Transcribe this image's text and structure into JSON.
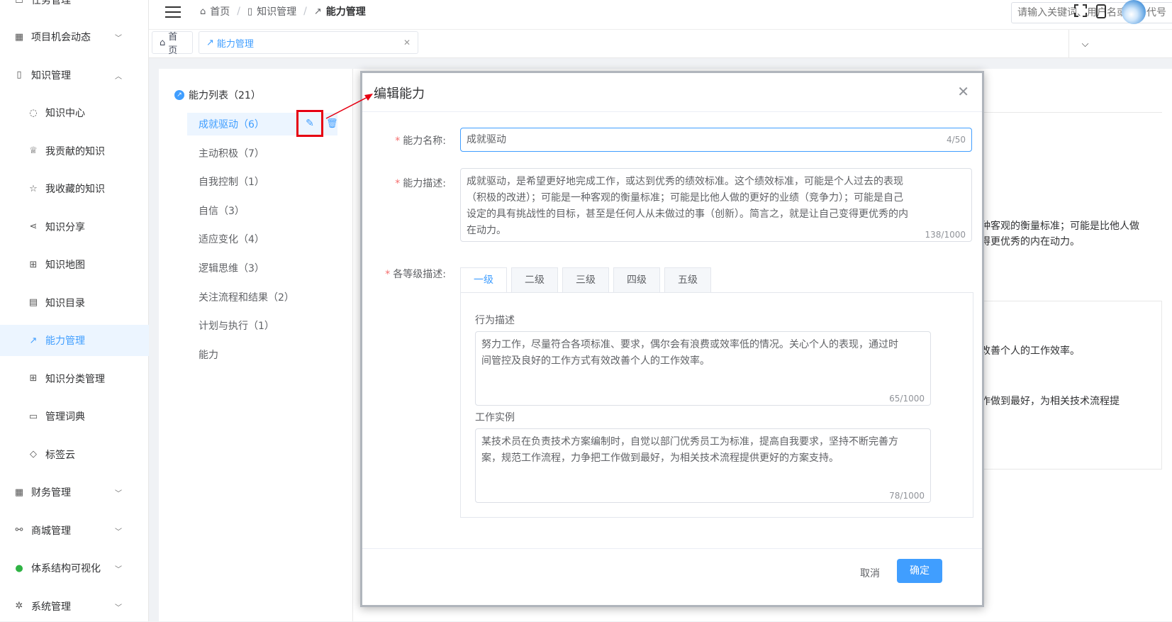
{
  "sidebar": {
    "top_partial": "任务管理",
    "items": [
      {
        "label": "项目机会动态",
        "icon": "calendar-icon",
        "type": "top",
        "chevron": "down"
      },
      {
        "label": "知识管理",
        "icon": "book-icon",
        "type": "top",
        "chevron": "up"
      },
      {
        "label": "知识中心",
        "icon": "bulb-icon",
        "type": "sub"
      },
      {
        "label": "我贡献的知识",
        "icon": "trophy-icon",
        "type": "sub"
      },
      {
        "label": "我收藏的知识",
        "icon": "star-icon",
        "type": "sub"
      },
      {
        "label": "知识分享",
        "icon": "share-icon",
        "type": "sub"
      },
      {
        "label": "知识地图",
        "icon": "sitemap-icon",
        "type": "sub"
      },
      {
        "label": "知识目录",
        "icon": "list-icon",
        "type": "sub"
      },
      {
        "label": "能力管理",
        "icon": "trend-icon",
        "type": "sub",
        "active": true
      },
      {
        "label": "知识分类管理",
        "icon": "grid-icon",
        "type": "sub"
      },
      {
        "label": "管理词典",
        "icon": "dictionary-icon",
        "type": "sub"
      },
      {
        "label": "标签云",
        "icon": "tag-icon",
        "type": "sub"
      },
      {
        "label": "财务管理",
        "icon": "table-icon",
        "type": "top",
        "chevron": "down"
      },
      {
        "label": "商城管理",
        "icon": "shop-icon",
        "type": "top",
        "chevron": "down"
      },
      {
        "label": "体系结构可视化",
        "icon": "user-icon",
        "type": "top",
        "chevron": "down"
      },
      {
        "label": "系统管理",
        "icon": "gear-icon",
        "type": "top",
        "chevron": "down"
      }
    ]
  },
  "header": {
    "breadcrumb": [
      "首页",
      "知识管理",
      "能力管理"
    ],
    "search_placeholder": "请输入关键词、用户名或项目代号"
  },
  "tabs": [
    {
      "label": "首页",
      "icon": "home-icon"
    },
    {
      "label": "能力管理",
      "icon": "trend-icon",
      "active": true
    }
  ],
  "tree": {
    "root": "能力列表（21）",
    "items": [
      "成就驱动（6）",
      "主动积极（7）",
      "自我控制（1）",
      "自信（3）",
      "适应变化（4）",
      "逻辑思维（3）",
      "关注流程和结果（2）",
      "计划与执行（1）",
      "能力"
    ]
  },
  "background": {
    "line1": "种客观的衡量标准；可能是比他人做",
    "line2": "得更优秀的内在动力。",
    "line3": "改善个人的工作效率。",
    "line4": "作做到最好，为相关技术流程提"
  },
  "dialog": {
    "title": "编辑能力",
    "name_label": "能力名称:",
    "name_value": "成就驱动",
    "name_count": "4/50",
    "desc_label": "能力描述:",
    "desc_lines": [
      "成就驱动，是希望更好地完成工作，或达到优秀的绩效标准。这个绩效标准，可能是个人过去的表现",
      "（积极的改进）；可能是一种客观的衡量标准；可能是比他人做的更好的业绩（竞争力）；可能是自己",
      "设定的具有挑战性的目标，甚至是任何人从未做过的事（创新）。简言之，就是让自己变得更优秀的内",
      "在动力。"
    ],
    "desc_count": "138/1000",
    "levels_label": "各等级描述:",
    "level_tabs": [
      "一级",
      "二级",
      "三级",
      "四级",
      "五级"
    ],
    "behavior_label": "行为描述",
    "behavior_lines": [
      "努力工作，尽量符合各项标准、要求，偶尔会有浪费或效率低的情况。关心个人的表现，通过时",
      "间管控及良好的工作方式有效改善个人的工作效率。"
    ],
    "behavior_count": "65/1000",
    "example_label": "工作实例",
    "example_lines": [
      "某技术员在负责技术方案编制时，自觉以部门优秀员工为标准，提高自我要求，坚持不断完善方",
      "案，规范工作流程，力争把工作做到最好，为相关技术流程提供更好的方案支持。"
    ],
    "example_count": "78/1000",
    "cancel": "取消",
    "confirm": "确定"
  },
  "colors": {
    "accent": "#409eff",
    "highlight": "#e60012",
    "required": "#f56c6c"
  }
}
